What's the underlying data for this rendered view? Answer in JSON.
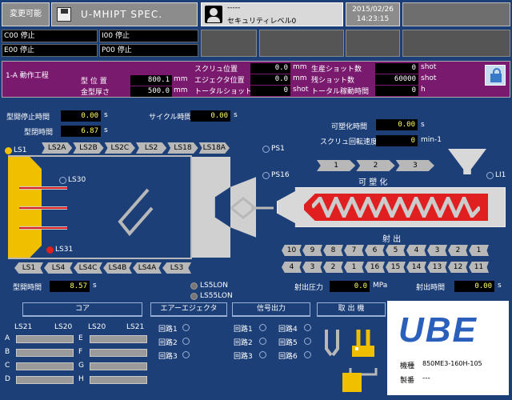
{
  "header": {
    "mode_btn": "変更可能",
    "title": "U-MHIPT SPEC.",
    "user_dashes": "-----",
    "security": "セキュリティレベル0",
    "date": "2015/02/26",
    "time": "14:23:15"
  },
  "status": {
    "c00": "C00 停止",
    "i00": "I00 停止",
    "e00": "E00 停止",
    "p00": "P00 停止"
  },
  "process": {
    "label": "1-A 動作工程",
    "mold_pos_label": "型 位 置",
    "mold_pos": "800.1",
    "mold_pos_unit": "mm",
    "mold_thick_label": "金型厚さ",
    "mold_thick": "500.0",
    "mold_thick_unit": "mm",
    "screw_pos_label": "スクリュ位置",
    "screw_pos": "0.0",
    "screw_pos_unit": "mm",
    "ejector_pos_label": "エジェクタ位置",
    "ejector_pos": "0.0",
    "ejector_pos_unit": "mm",
    "total_shot_label": "トータルショット数",
    "total_shot": "0",
    "total_shot_unit": "shot",
    "prod_shot_label": "生産ショット数",
    "prod_shot": "0",
    "prod_shot_unit": "shot",
    "remain_shot_label": "残ショット数",
    "remain_shot": "60000",
    "remain_shot_unit": "shot",
    "total_run_label": "トータル稼動時間",
    "total_run": "0",
    "total_run_unit": "h"
  },
  "timers": {
    "open_stop_label": "型開停止時間",
    "open_stop": "0.00",
    "open_stop_unit": "s",
    "close_label": "型閉時間",
    "close": "6.87",
    "close_unit": "s",
    "cycle_label": "サイクル時間",
    "cycle": "0.00",
    "cycle_unit": "s",
    "open_label": "型開時間",
    "open": "8.57",
    "open_unit": "s",
    "plastic_label": "可塑化時間",
    "plastic": "0.00",
    "plastic_unit": "s",
    "screw_speed_label": "スクリュ回転速度",
    "screw_speed": "0",
    "screw_speed_unit": "min-1",
    "inj_press_label": "射出圧力",
    "inj_press": "0.0",
    "inj_press_unit": "MPa",
    "inj_time_label": "射出時間",
    "inj_time": "0.00",
    "inj_time_unit": "s"
  },
  "limits": {
    "ls1": "LS1",
    "ls30": "LS30",
    "ls31": "LS31",
    "ps1": "PS1",
    "ps16": "PS16",
    "li1": "LI1",
    "ls5lon": "LS5LON",
    "ls55lon": "LS55LON"
  },
  "top_arrows": [
    "LS2A",
    "LS2B",
    "LS2C",
    "LS2",
    "LS18",
    "LS18A"
  ],
  "bottom_arrows": [
    "LS1",
    "LS4",
    "LS4C",
    "LS4B",
    "LS4A",
    "LS3"
  ],
  "plast_arrows": [
    "1",
    "2",
    "3"
  ],
  "plast_label": "可 塑 化",
  "inject_label": "射 出",
  "inject_row1": [
    "10",
    "9",
    "8",
    "7",
    "6",
    "5",
    "4",
    "3",
    "2",
    "1"
  ],
  "inject_row2": [
    "4",
    "3",
    "2",
    "1",
    "16",
    "15",
    "14",
    "13",
    "12",
    "11"
  ],
  "sections": {
    "core": "コア",
    "air": "エアーエジェクタ",
    "signal": "信号出力",
    "takeout": "取 出 機"
  },
  "core_cols": [
    "LS21",
    "LS20",
    "LS20",
    "LS21"
  ],
  "core_rows_left": [
    "A",
    "B",
    "C",
    "D"
  ],
  "core_rows_right": [
    "E",
    "F",
    "G",
    "H"
  ],
  "circuits_left": [
    "回路1",
    "回路2",
    "回路3"
  ],
  "circuits_right": [
    "回路1",
    "回路2",
    "回路3"
  ],
  "circuits_right2": [
    "回路4",
    "回路5",
    "回路6"
  ],
  "brand": {
    "logo": "UBE",
    "model_label": "機種",
    "model": "850ME3-160H-105",
    "serial_label": "製番",
    "serial": "---"
  },
  "colors": {
    "bg": "#1d3f78",
    "yellow": "#f0c000",
    "barrel_red": "#e02020",
    "purple": "#7a1a6e"
  }
}
